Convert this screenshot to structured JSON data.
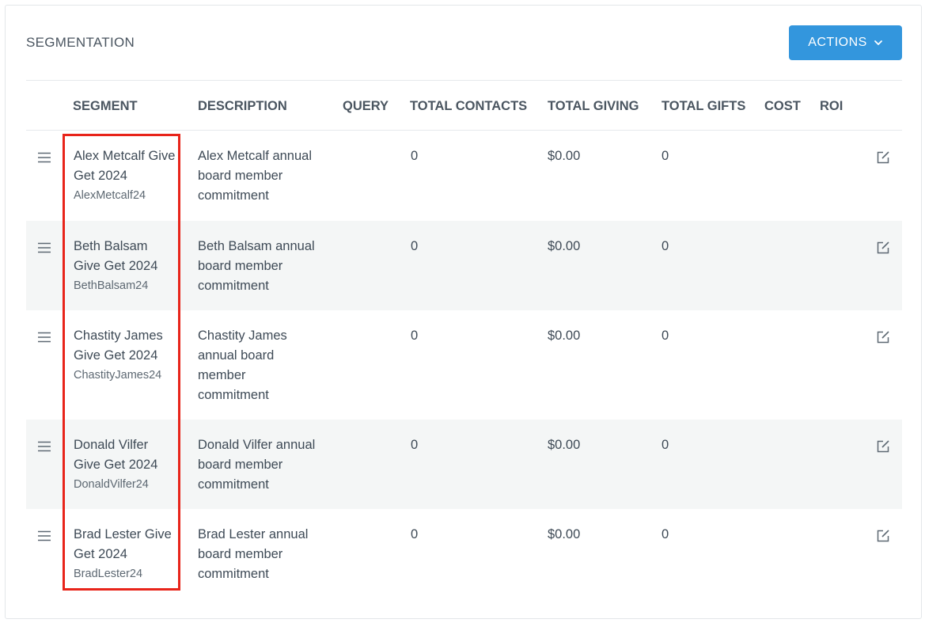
{
  "panel": {
    "title": "SEGMENTATION",
    "actions_label": "ACTIONS"
  },
  "icons": {
    "actions_chevron": "chevron-down-icon",
    "row_drag": "drag-handle-icon",
    "row_edit": "edit-icon"
  },
  "colors": {
    "accent": "#3396dd",
    "highlight": "#e8241a",
    "alt_row": "#f4f6f6"
  },
  "table": {
    "headers": {
      "segment": "SEGMENT",
      "description": "DESCRIPTION",
      "query": "QUERY",
      "total_contacts": "TOTAL CONTACTS",
      "total_giving": "TOTAL GIVING",
      "total_gifts": "TOTAL GIFTS",
      "cost": "COST",
      "roi": "ROI"
    },
    "rows": [
      {
        "name": "Alex Metcalf Give Get 2024",
        "code": "AlexMetcalf24",
        "description": "Alex Metcalf annual board member commitment",
        "query": "",
        "total_contacts": "0",
        "total_giving": "$0.00",
        "total_gifts": "0",
        "cost": "",
        "roi": ""
      },
      {
        "name": "Beth Balsam Give Get 2024",
        "code": "BethBalsam24",
        "description": "Beth Balsam annual board member commitment",
        "query": "",
        "total_contacts": "0",
        "total_giving": "$0.00",
        "total_gifts": "0",
        "cost": "",
        "roi": ""
      },
      {
        "name": "Chastity James Give Get 2024",
        "code": "ChastityJames24",
        "description": "Chastity James annual board member commitment",
        "query": "",
        "total_contacts": "0",
        "total_giving": "$0.00",
        "total_gifts": "0",
        "cost": "",
        "roi": ""
      },
      {
        "name": "Donald Vilfer Give Get 2024",
        "code": "DonaldVilfer24",
        "description": "Donald Vilfer annual board member commitment",
        "query": "",
        "total_contacts": "0",
        "total_giving": "$0.00",
        "total_gifts": "0",
        "cost": "",
        "roi": ""
      },
      {
        "name": "Brad Lester Give Get 2024",
        "code": "BradLester24",
        "description": "Brad Lester annual board member commitment",
        "query": "",
        "total_contacts": "0",
        "total_giving": "$0.00",
        "total_gifts": "0",
        "cost": "",
        "roi": ""
      }
    ]
  }
}
